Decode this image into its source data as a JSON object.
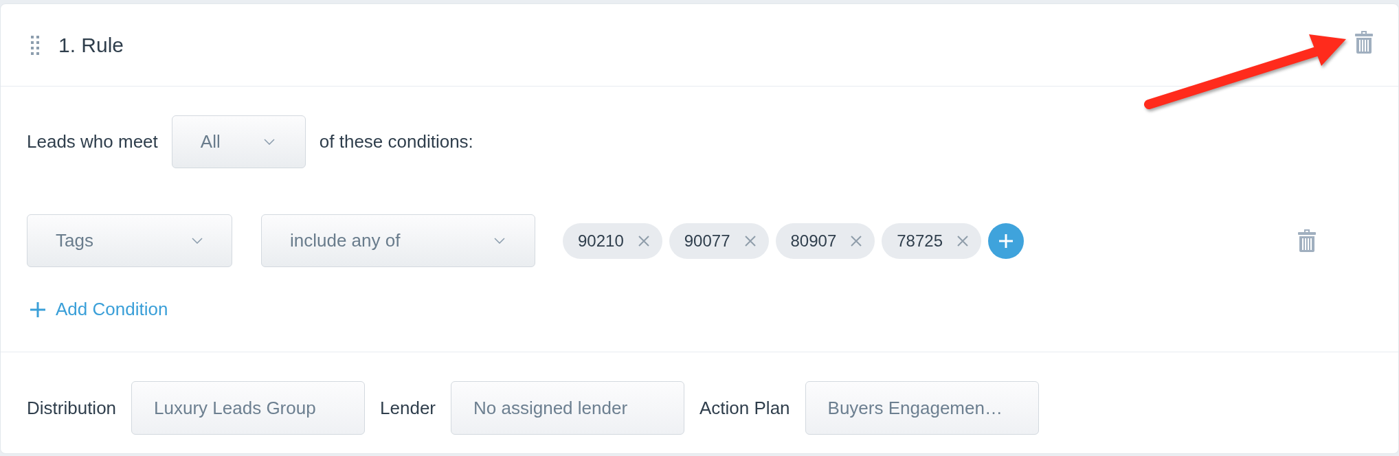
{
  "rule": {
    "title": "1. Rule"
  },
  "match": {
    "prefix": "Leads who meet",
    "value": "All",
    "suffix": "of these conditions:"
  },
  "conditions": [
    {
      "field": "Tags",
      "operator": "include any of",
      "tags": [
        "90210",
        "90077",
        "80907",
        "78725"
      ]
    }
  ],
  "add_condition": {
    "label": "Add Condition"
  },
  "assignments": [
    {
      "label": "Distribution",
      "value": "Luxury Leads Group"
    },
    {
      "label": "Lender",
      "value": "No assigned lender"
    },
    {
      "label": "Action Plan",
      "value": "Buyers Engagemen…"
    }
  ]
}
